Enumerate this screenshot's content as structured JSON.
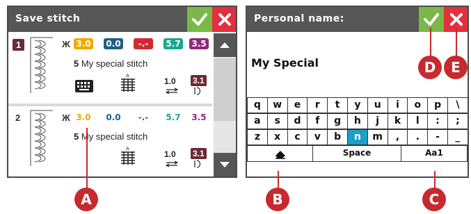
{
  "left_dialog": {
    "title": "Save stitch",
    "confirm_icon": "checkmark-icon",
    "close_icon": "x-icon",
    "stitches": [
      {
        "number": "1",
        "selected": true,
        "values": [
          "3.0",
          "0.0",
          "-.-",
          "5.7",
          "3.5"
        ],
        "value_colors": [
          "#f2a900",
          "#1e5f86",
          "#d6272e",
          "#1aa88c",
          "#8e2a7e"
        ],
        "slot": "5",
        "name": "My special stitch",
        "length": "1.0",
        "density": "3.1"
      },
      {
        "number": "2",
        "selected": false,
        "values": [
          "3.0",
          "0.0",
          "-.-",
          "5.7",
          "3.5"
        ],
        "value_colors": [
          "#f2a900",
          "#1e5f86",
          "#d6272e",
          "#1aa88c",
          "#8e2a7e"
        ],
        "slot": "5",
        "name": "My special stitch",
        "length": "1.0",
        "density": "3.1"
      }
    ]
  },
  "right_dialog": {
    "title": "Personal name:",
    "name_value": "My Special",
    "keyboard": {
      "rows": [
        [
          "q",
          "w",
          "e",
          "r",
          "t",
          "y",
          "u",
          "i",
          "o",
          "p",
          "\\"
        ],
        [
          "a",
          "s",
          "d",
          "f",
          "g",
          "h",
          "j",
          "k",
          "l",
          ":",
          ";"
        ],
        [
          "z",
          "x",
          "c",
          "v",
          "b",
          "n",
          "m",
          ",",
          ".",
          "-",
          "_"
        ]
      ],
      "active_key": "n",
      "space_label": "Space",
      "mode_label": "Aa1",
      "backspace_icon": "eraser-icon"
    }
  },
  "callouts": {
    "a": "A",
    "b": "B",
    "c": "C",
    "d": "D",
    "e": "E"
  },
  "colors": {
    "titlebar": "#565656",
    "confirm": "#7ab848",
    "cancel": "#e3303c",
    "callout": "#c72a2e",
    "active_key": "#1e9fc9",
    "badge": "#6b2a36"
  }
}
